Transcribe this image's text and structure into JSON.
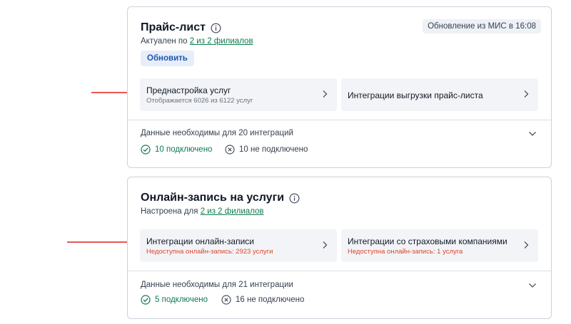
{
  "price_list": {
    "title": "Прайс-лист",
    "update_badge": "Обновление из МИС в 16:08",
    "actual_prefix": "Актуален по ",
    "actual_link": "2 из 2 филиалов",
    "refresh_label": "Обновить",
    "tile_presetup": {
      "title": "Преднастройка услуг",
      "subtitle": "Отображается 6026 из 6122 услуг"
    },
    "tile_export": {
      "title": "Интеграции выгрузки прайс-листа"
    },
    "requirements": "Данные необходимы для 20 интеграций",
    "connected": "10 подключено",
    "not_connected": "10 не подключено"
  },
  "online_booking": {
    "title": "Онлайн-запись на услуги",
    "configured_prefix": "Настроена для ",
    "configured_link": "2 из 2 филиалов",
    "tile_booking": {
      "title": "Интеграции онлайн-записи",
      "subtitle": "Недоступна онлайн-запись: 2923 услуги"
    },
    "tile_insurance": {
      "title": "Интеграции со страховыми компаниями",
      "subtitle": "Недоступна онлайн-запись: 1 услуга"
    },
    "requirements": "Данные необходимы для 21 интеграции",
    "connected": "5 подключено",
    "not_connected": "16 не подключено"
  },
  "colors": {
    "accent_green": "#0f7a4f",
    "warning_red": "#e0452f",
    "button_blue": "#1e56b3",
    "arrow_red": "#e0211b"
  }
}
